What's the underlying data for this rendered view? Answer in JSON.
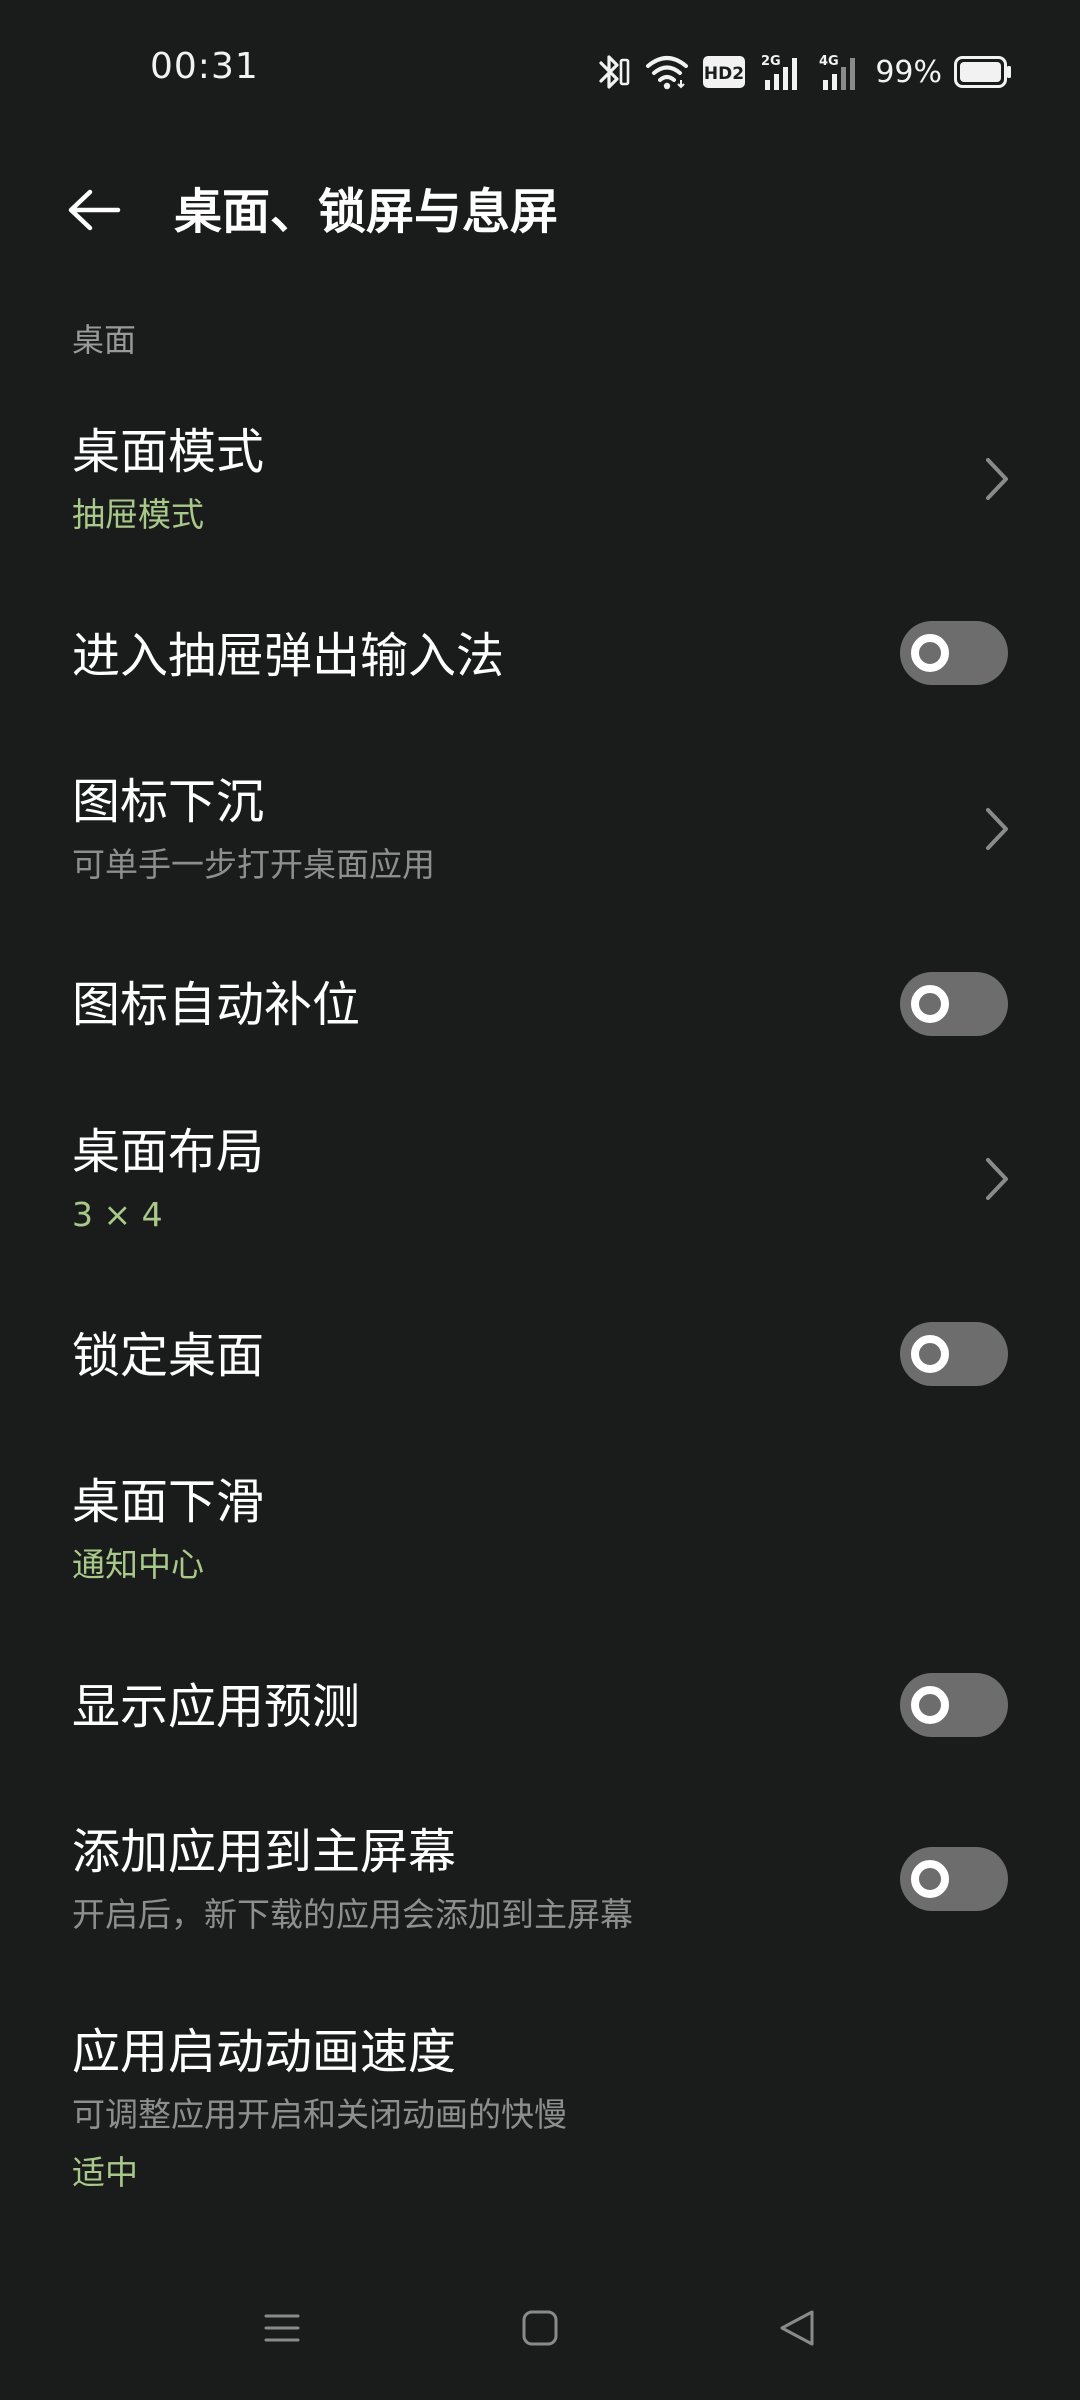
{
  "status_bar": {
    "time": "00:31",
    "battery_percent": "99%",
    "icons": [
      "bluetooth-icon",
      "wifi-icon",
      "hd-voice-icon",
      "signal-2g-icon",
      "signal-4g-icon",
      "battery-icon"
    ],
    "hd_label": "HD2",
    "sim1_label": "2G",
    "sim2_label": "4G"
  },
  "app_bar": {
    "title": "桌面、锁屏与息屏",
    "back_icon": "arrow-left-icon"
  },
  "section": {
    "header": "桌面"
  },
  "settings": {
    "desktop_mode": {
      "title": "桌面模式",
      "value": "抽屉模式"
    },
    "drawer_keyboard": {
      "title": "进入抽屉弹出输入法",
      "enabled": false
    },
    "icon_sink": {
      "title": "图标下沉",
      "subtitle": "可单手一步打开桌面应用"
    },
    "icon_autofill": {
      "title": "图标自动补位",
      "enabled": false
    },
    "desktop_layout": {
      "title": "桌面布局",
      "value": "3 × 4"
    },
    "lock_desktop": {
      "title": "锁定桌面",
      "enabled": false
    },
    "swipe_down": {
      "title": "桌面下滑",
      "value": "通知中心"
    },
    "app_prediction": {
      "title": "显示应用预测",
      "enabled": false
    },
    "add_to_home": {
      "title": "添加应用到主屏幕",
      "subtitle": "开启后，新下载的应用会添加到主屏幕",
      "enabled": false
    },
    "anim_speed": {
      "title": "应用启动动画速度",
      "subtitle": "可调整应用开启和关闭动画的快慢",
      "value": "适中"
    }
  },
  "nav_bar": {
    "icons": [
      "menu-icon",
      "home-icon",
      "back-triangle-icon"
    ]
  },
  "colors": {
    "background": "#1a1b1b",
    "accent_value": "#a9c98a",
    "toggle_off": "#6d6d6d"
  }
}
